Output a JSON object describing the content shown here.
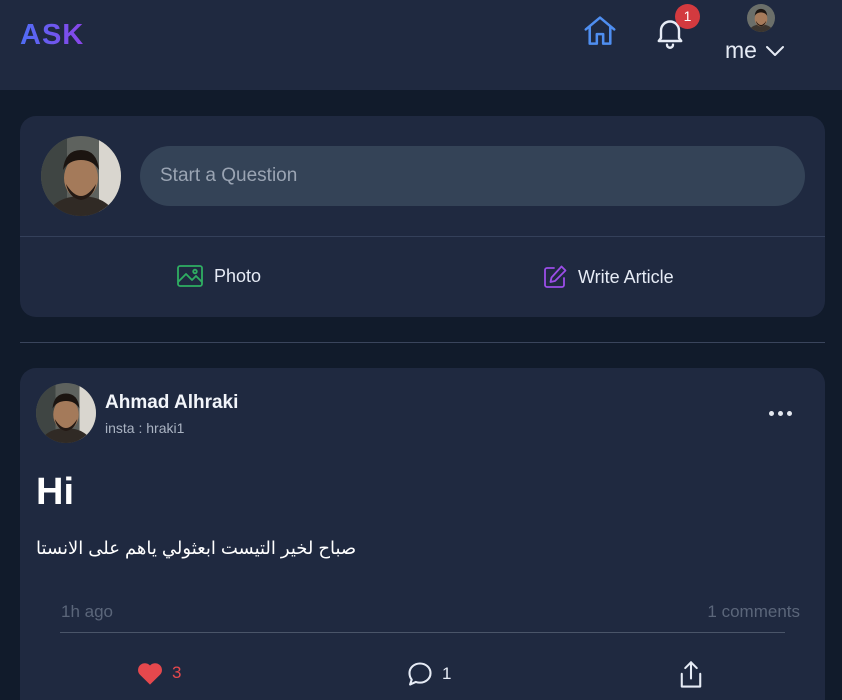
{
  "header": {
    "logo": "ASK",
    "notifications_count": "1",
    "profile_label": "me",
    "icons": [
      "home-icon",
      "bell-icon",
      "chevron-down-icon"
    ]
  },
  "composer": {
    "placeholder": "Start a Question",
    "photo_label": "Photo",
    "write_article_label": "Write Article",
    "icons": [
      "image-icon",
      "pencil-square-icon"
    ]
  },
  "post": {
    "author_name": "Ahmad Alhraki",
    "author_sub": "insta : hraki1",
    "title": "Hi",
    "body": "صباح لخير التيست ابعثولي ياهم على الانستا",
    "time": "1h ago",
    "comments_summary": "1 comments",
    "likes": "3",
    "comments": "1",
    "icons": [
      "more-dots-icon",
      "heart-icon",
      "comment-icon",
      "share-icon"
    ]
  },
  "colors": {
    "background": "#111b2b",
    "card": "#1f2940",
    "input": "#344357",
    "accent_blue": "#4f8ef0",
    "photo_green": "#2fae62",
    "article_purple": "#9b4de8",
    "like_red": "#e5484d",
    "badge_red": "#d33a3f"
  }
}
